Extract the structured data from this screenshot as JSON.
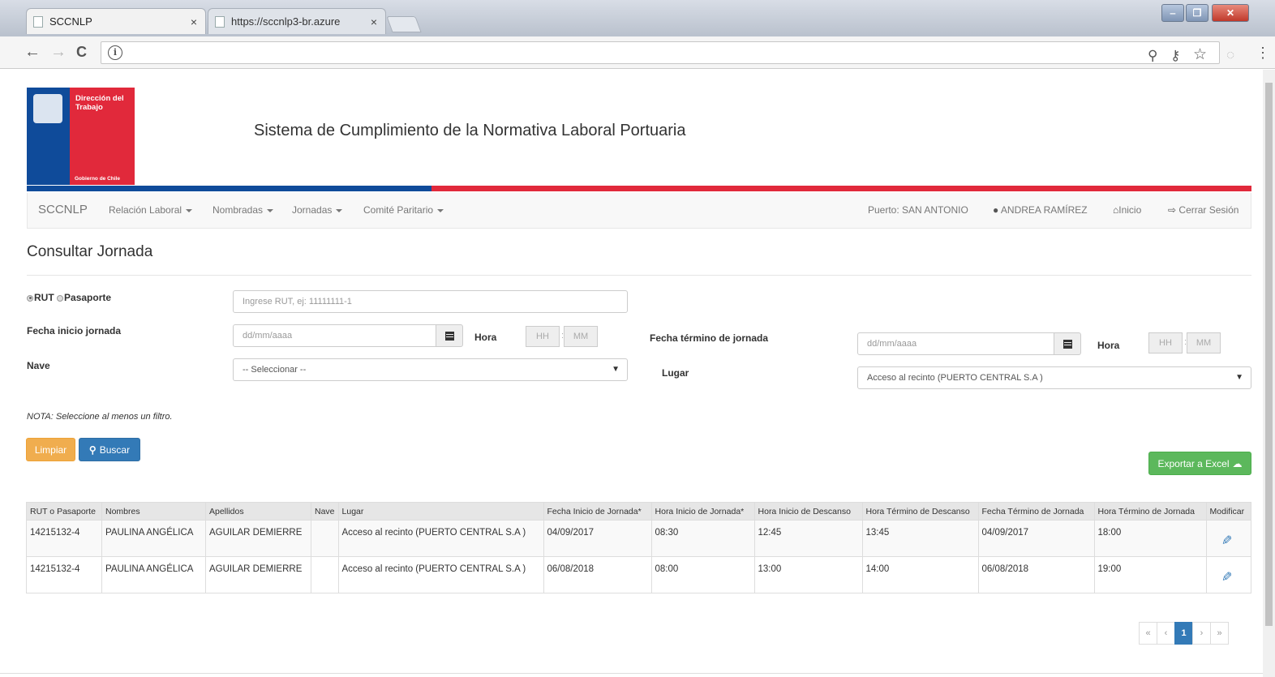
{
  "browser": {
    "tabs": [
      {
        "title": "SCCNLP",
        "close": "×",
        "active": true
      },
      {
        "title": "https://sccnlp3-br.azure",
        "close": "×",
        "active": false
      }
    ],
    "window_buttons": {
      "minimize": "‒",
      "maximize": "❐",
      "close": "✕"
    },
    "nav": {
      "back": "←",
      "forward": "→",
      "reload": "C",
      "info": "i"
    },
    "omnibox_icons": {
      "zoom": "⚲",
      "passwords": "⚷",
      "bookmark": "☆",
      "extension": "◌",
      "menu": "⋮"
    }
  },
  "header": {
    "logo_title": "Dirección del Trabajo",
    "logo_subtitle": "Gobierno de Chile",
    "site_title": "Sistema de Cumplimiento de la Normativa Laboral Portuaria"
  },
  "navbar": {
    "brand": "SCCNLP",
    "menus": [
      "Relación Laboral",
      "Nombradas",
      "Jornadas",
      "Comité Paritario"
    ],
    "puerto": "Puerto: SAN ANTONIO",
    "user": "ANDREA RAMÍREZ",
    "inicio": "Inicio",
    "logout": "Cerrar Sesión"
  },
  "form": {
    "heading": "Consultar Jornada",
    "radio_rut": "RUT",
    "radio_pasaporte": "Pasaporte",
    "rut_placeholder": "Ingrese RUT, ej: 11111111-1",
    "fecha_inicio_label": "Fecha inicio jornada",
    "fecha_placeholder": "dd/mm/aaaa",
    "hora_label": "Hora",
    "hh": "HH",
    "mm": "MM",
    "hm_sep": ":",
    "fecha_termino_label": "Fecha término de jornada",
    "nave_label": "Nave",
    "nave_value": "-- Seleccionar --",
    "lugar_label": "Lugar",
    "lugar_value": "Acceso al recinto (PUERTO CENTRAL S.A )",
    "nota": "NOTA: Seleccione al menos un filtro.",
    "btn_limpiar": "Limpiar",
    "btn_buscar": "Buscar",
    "btn_excel": "Exportar a Excel"
  },
  "table": {
    "headers": [
      "RUT o Pasaporte",
      "Nombres",
      "Apellidos",
      "Nave",
      "Lugar",
      "Fecha Inicio de Jornada*",
      "Hora Inicio de Jornada*",
      "Hora Inicio de Descanso",
      "Hora Término de Descanso",
      "Fecha Término de Jornada",
      "Hora Término de Jornada",
      "Modificar"
    ],
    "rows": [
      [
        "14215132-4",
        "PAULINA ANGÉLICA",
        "AGUILAR DEMIERRE",
        "",
        "Acceso al recinto (PUERTO CENTRAL S.A )",
        "04/09/2017",
        "08:30",
        "12:45",
        "13:45",
        "04/09/2017",
        "18:00"
      ],
      [
        "14215132-4",
        "PAULINA ANGÉLICA",
        "AGUILAR DEMIERRE",
        "",
        "Acceso al recinto (PUERTO CENTRAL S.A )",
        "06/08/2018",
        "08:00",
        "13:00",
        "14:00",
        "06/08/2018",
        "19:00"
      ]
    ]
  },
  "pagination": {
    "first": "«",
    "prev": "‹",
    "current": "1",
    "next": "›",
    "last": "»"
  },
  "colors": {
    "brand_blue": "#0f4b9a",
    "brand_red": "#e1293b",
    "primary": "#337ab7",
    "warning": "#f0ad4e",
    "success": "#5cb85c"
  }
}
